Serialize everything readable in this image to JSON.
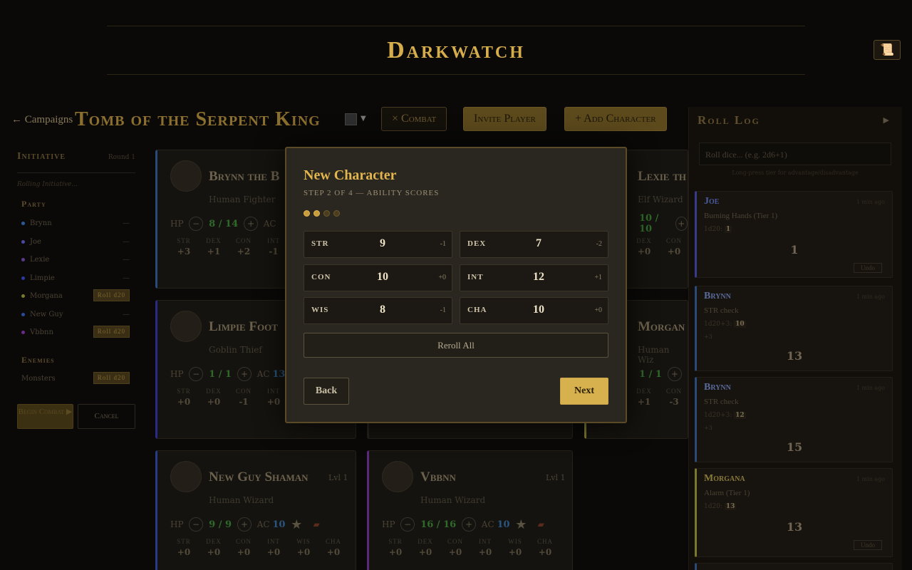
{
  "app": {
    "title": "Darkwatch",
    "scroll_icon": "scroll-icon"
  },
  "header": {
    "back_label": "← Campaigns",
    "campaign_title": "Tomb of the Serpent King",
    "combat_label": "× Combat",
    "invite_label": "Invite Player",
    "add_label": "+ Add Character"
  },
  "sidebar": {
    "title": "Initiative",
    "round": "Round 1",
    "rolling": "Rolling Initiative...",
    "party_label": "Party",
    "party": [
      {
        "name": "Brynn",
        "color": "#2a5a9a",
        "value": "—"
      },
      {
        "name": "Joe",
        "color": "#4a4aa0",
        "value": "—"
      },
      {
        "name": "Lexie",
        "color": "#5a3a8a",
        "value": "—"
      },
      {
        "name": "Limpie",
        "color": "#2a3aa0",
        "value": "—"
      },
      {
        "name": "Morgana",
        "color": "#7a7a2a",
        "value": "Roll d20"
      },
      {
        "name": "New Guy",
        "color": "#2a4a9a",
        "value": "—"
      },
      {
        "name": "Vbbnn",
        "color": "#6a2a8a",
        "value": "Roll d20"
      }
    ],
    "enemies_label": "Enemies",
    "enemies": [
      {
        "name": "Monsters",
        "value": "Roll d20"
      }
    ],
    "begin_label": "Begin Combat ▶",
    "cancel_label": "Cancel"
  },
  "cards": [
    {
      "name": "Brynn the B",
      "sub": "Human Fighter",
      "hp": "8 / 14",
      "ac_label": "AC",
      "ac": "",
      "border": "#2a4a7a",
      "stats": [
        {
          "l": "STR",
          "v": "+3"
        },
        {
          "l": "DEX",
          "v": "+1"
        },
        {
          "l": "CON",
          "v": "+2"
        },
        {
          "l": "INT",
          "v": "-1"
        }
      ]
    },
    {
      "name": "Limpie Foot",
      "sub": "Goblin Thief",
      "hp": "1 / 1",
      "ac_label": "AC",
      "ac": "13",
      "border": "#2a2a8a",
      "stats": [
        {
          "l": "STR",
          "v": "+0"
        },
        {
          "l": "DEX",
          "v": "+0"
        },
        {
          "l": "CON",
          "v": "-1"
        },
        {
          "l": "INT",
          "v": "+0"
        }
      ]
    },
    {
      "name": "New Guy Shaman",
      "lvl": "Lvl 1",
      "sub": "Human Wizard",
      "hp": "9 / 9",
      "ac_label": "AC",
      "ac": "10",
      "border": "#2a3a8a",
      "stats": [
        {
          "l": "STR",
          "v": "+0"
        },
        {
          "l": "DEX",
          "v": "+0"
        },
        {
          "l": "CON",
          "v": "+0"
        },
        {
          "l": "INT",
          "v": "+0"
        },
        {
          "l": "WIS",
          "v": "+0"
        },
        {
          "l": "CHA",
          "v": "+0"
        }
      ]
    },
    {
      "name": "Vbbnn",
      "lvl": "Lvl 1",
      "sub": "Human Wizard",
      "hp": "16 / 16",
      "ac_label": "AC",
      "ac": "10",
      "border": "#5a2a7a",
      "stats": [
        {
          "l": "STR",
          "v": "+0"
        },
        {
          "l": "DEX",
          "v": "+0"
        },
        {
          "l": "CON",
          "v": "+0"
        },
        {
          "l": "INT",
          "v": "+0"
        },
        {
          "l": "WIS",
          "v": "+0"
        },
        {
          "l": "CHA",
          "v": "+0"
        }
      ]
    },
    {
      "name": "Lexie th",
      "sub": "Elf Wizard",
      "hp": "10 / 10",
      "border": "#5a3a8a",
      "stats": [
        {
          "l": "DEX",
          "v": "+0"
        },
        {
          "l": "CON",
          "v": "+0"
        }
      ]
    },
    {
      "name": "Morgan",
      "sub": "Human Wiz",
      "hp": "1 / 1",
      "border": "#7a7a2a",
      "stats": [
        {
          "l": "DEX",
          "v": "+1"
        },
        {
          "l": "CON",
          "v": "-3"
        }
      ]
    }
  ],
  "log": {
    "title": "Roll Log",
    "input_placeholder": "Roll dice... (e.g. 2d6+1)",
    "hint": "Long-press tier for advantage/disadvantage",
    "entries": [
      {
        "name": "Joe",
        "time": "1 min ago",
        "desc": "Burning Hands (Tier 1)",
        "formula": "1d20: ",
        "die": "1",
        "result": "1",
        "undo": "Undo",
        "color": "#3a3a8a"
      },
      {
        "name": "Brynn",
        "time": "1 min ago",
        "desc": "STR check",
        "formula": "1d20+3: ",
        "die": "10",
        "mod": "+3",
        "result": "13",
        "color": "#2a4a7a"
      },
      {
        "name": "Brynn",
        "time": "1 min ago",
        "desc": "STR check",
        "formula": "1d20+3: ",
        "die": "12",
        "mod": "+3",
        "result": "15",
        "color": "#2a4a7a"
      },
      {
        "name": "Morgana",
        "time": "1 min ago",
        "desc": "Alarm (Tier 1)",
        "formula": "1d20: ",
        "die": "13",
        "result": "13",
        "undo": "Undo",
        "color": "#7a7a2a"
      }
    ]
  },
  "modal": {
    "title": "New Character",
    "step": "STEP 2 OF 4 — ABILITY SCORES",
    "progress": {
      "current": 2,
      "total": 4
    },
    "abilities": [
      {
        "name": "STR",
        "value": "9",
        "mod": "-1"
      },
      {
        "name": "DEX",
        "value": "7",
        "mod": "-2"
      },
      {
        "name": "CON",
        "value": "10",
        "mod": "+0"
      },
      {
        "name": "INT",
        "value": "12",
        "mod": "+1"
      },
      {
        "name": "WIS",
        "value": "8",
        "mod": "-1"
      },
      {
        "name": "CHA",
        "value": "10",
        "mod": "+0"
      }
    ],
    "reroll_label": "Reroll All",
    "back_label": "Back",
    "next_label": "Next"
  }
}
